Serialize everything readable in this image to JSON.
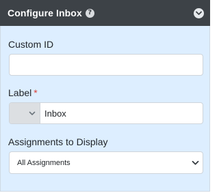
{
  "header": {
    "title": "Configure Inbox",
    "help_icon": "question-circle-icon",
    "collapse_icon": "chevron-down-circle-icon"
  },
  "fields": {
    "custom_id": {
      "label": "Custom ID",
      "value": "",
      "placeholder": ""
    },
    "label": {
      "label": "Label",
      "required_marker": "*",
      "value": "Inbox",
      "selector_icon": "chevron-down-icon"
    },
    "assignments": {
      "label": "Assignments to Display",
      "selected": "All Assignments",
      "caret_icon": "chevron-down-icon"
    }
  },
  "colors": {
    "header_bg": "#3d4247",
    "body_bg": "#ddeeff",
    "required": "#d9413a"
  }
}
